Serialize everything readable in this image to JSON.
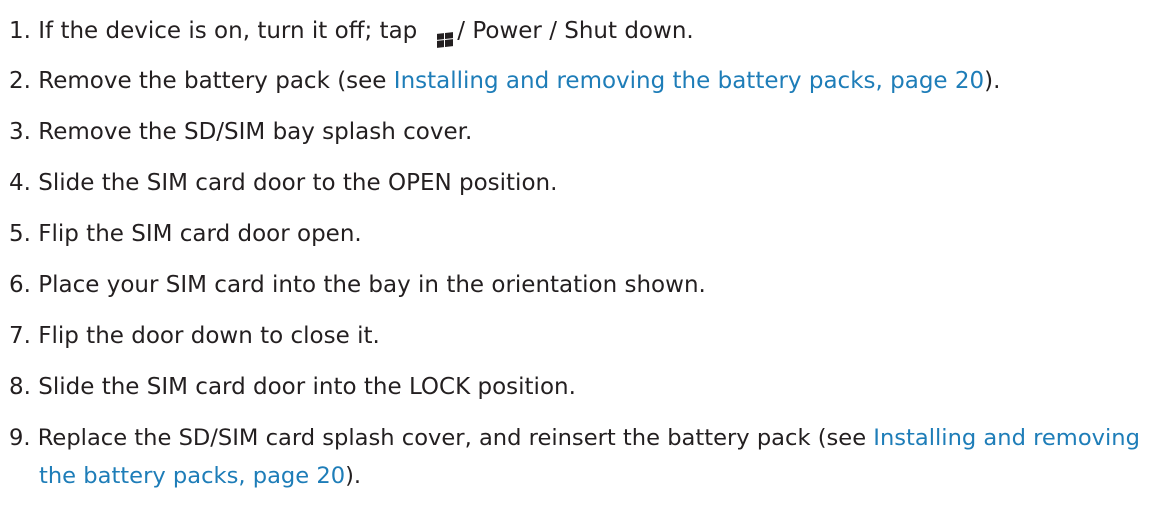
{
  "steps": [
    {
      "number": "1.",
      "parts": [
        {
          "text": "If the device is on, turn it off; tap"
        },
        {
          "icon": "windows-start-icon"
        },
        {
          "text": "/ Power / Shut down."
        }
      ]
    },
    {
      "number": "2.",
      "parts": [
        {
          "text": "Remove the battery pack (see "
        },
        {
          "link": "Installing and removing the battery packs, page 20"
        },
        {
          "text": ")."
        }
      ]
    },
    {
      "number": "3.",
      "text": "Remove the SD/SIM bay splash cover."
    },
    {
      "number": "4.",
      "text": "Slide the SIM card door to the OPEN position."
    },
    {
      "number": "5.",
      "text": "Flip the SIM card door open."
    },
    {
      "number": "6.",
      "text": "Place your SIM card into the bay in the orientation shown."
    },
    {
      "number": "7.",
      "text": "Flip the door down to close it."
    },
    {
      "number": "8.",
      "text": "Slide the SIM card door into the LOCK position."
    },
    {
      "number": "9.",
      "parts": [
        {
          "text": "Replace the SD/SIM card splash cover, and reinsert the battery pack (see "
        },
        {
          "link": "Installing and removing the battery packs, page 20"
        },
        {
          "text": ")."
        }
      ]
    }
  ],
  "colors": {
    "text": "#231f20",
    "link": "#1e7db8"
  }
}
